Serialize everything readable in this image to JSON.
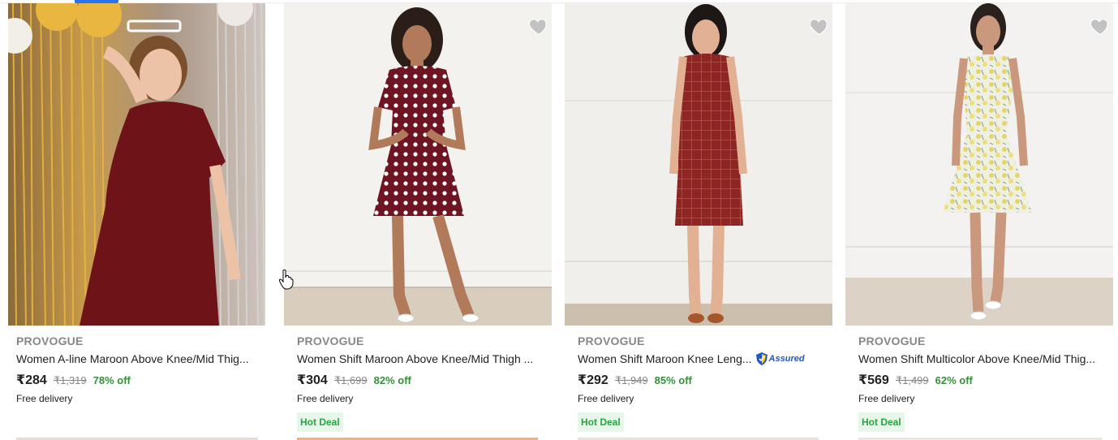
{
  "products": [
    {
      "brand": "PROVOGUE",
      "title": "Women A-line Maroon Above Knee/Mid Thig...",
      "price": "₹284",
      "mrp": "₹1,319",
      "discount": "78% off",
      "delivery": "Free delivery",
      "deal": "",
      "assured": "",
      "image_icon": "model-maroon-a-line-dress-photo"
    },
    {
      "brand": "PROVOGUE",
      "title": "Women Shift Maroon Above Knee/Mid Thigh ...",
      "price": "₹304",
      "mrp": "₹1,699",
      "discount": "82% off",
      "delivery": "Free delivery",
      "deal": "Hot Deal",
      "assured": "",
      "image_icon": "model-polka-dot-dress-photo"
    },
    {
      "brand": "PROVOGUE",
      "title": "Women Shift Maroon Knee Leng...",
      "price": "₹292",
      "mrp": "₹1,949",
      "discount": "85% off",
      "delivery": "Free delivery",
      "deal": "Hot Deal",
      "assured": "Assured",
      "image_icon": "model-checked-dress-photo"
    },
    {
      "brand": "PROVOGUE",
      "title": "Women Shift Multicolor Above Knee/Mid Thig...",
      "price": "₹569",
      "mrp": "₹1,499",
      "discount": "62% off",
      "delivery": "Free delivery",
      "deal": "Hot Deal",
      "assured": "",
      "image_icon": "model-floral-dress-photo"
    }
  ],
  "colors": {
    "brand_text": "#878787",
    "discount": "#388e3c",
    "deal_bg": "#e6f7ea",
    "deal_text": "#26a541",
    "assured": "#2455c3",
    "wishlist_heart": "#c2c2c2"
  }
}
